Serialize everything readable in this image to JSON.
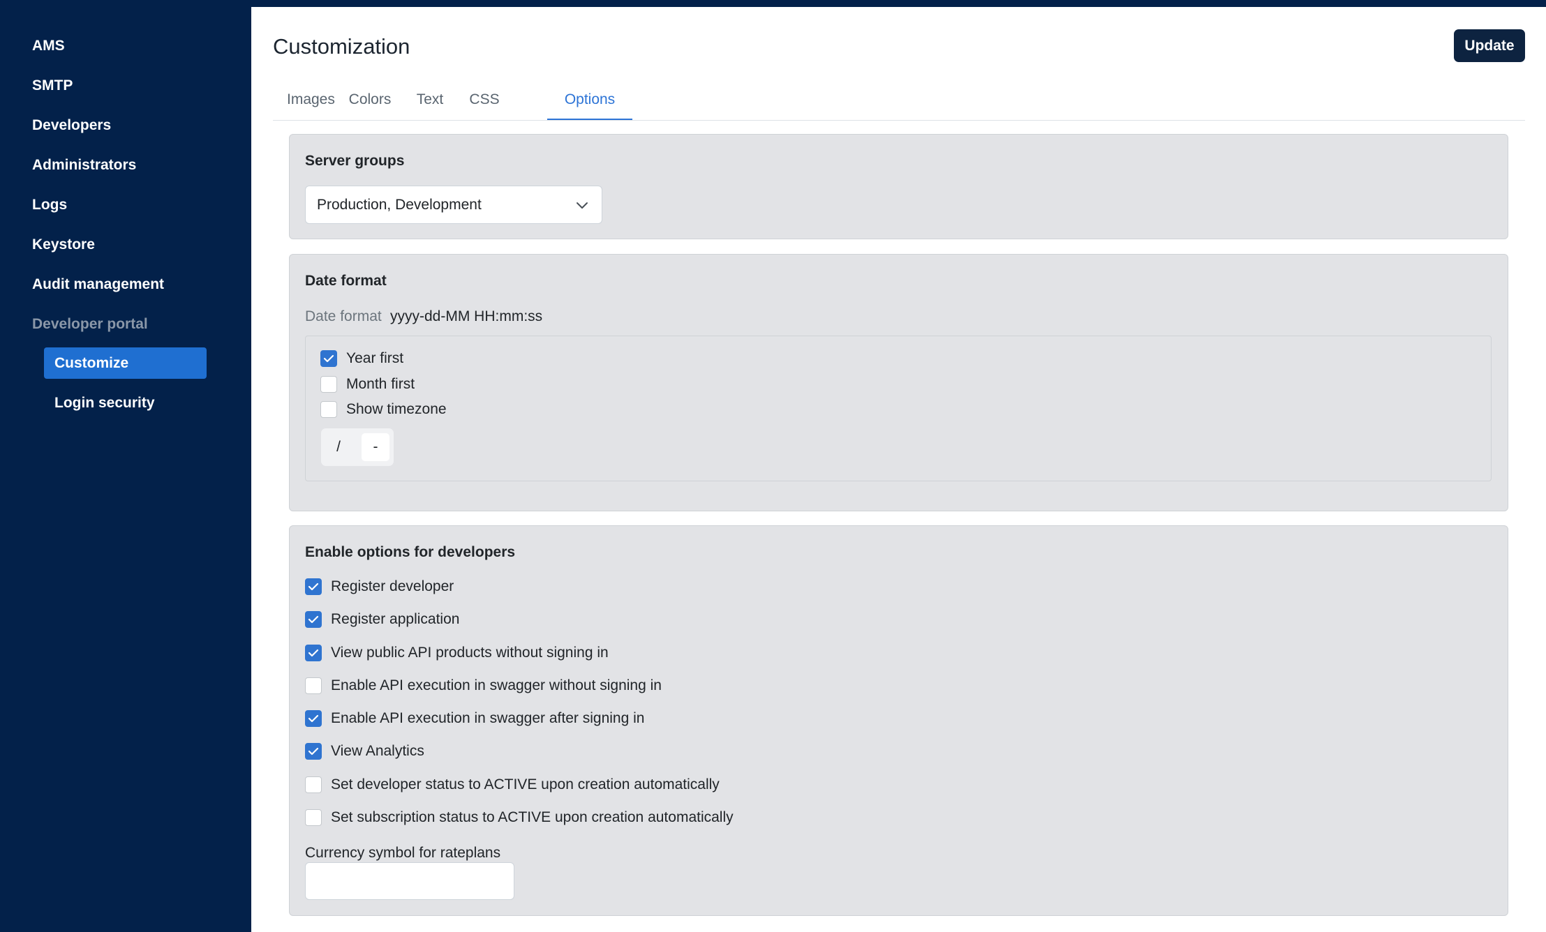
{
  "sidebar": {
    "items": [
      {
        "label": "AMS"
      },
      {
        "label": "SMTP"
      },
      {
        "label": "Developers"
      },
      {
        "label": "Administrators"
      },
      {
        "label": "Logs"
      },
      {
        "label": "Keystore"
      },
      {
        "label": "Audit management"
      },
      {
        "label": "Developer portal"
      }
    ],
    "sub_items": [
      {
        "label": "Customize",
        "active": true
      },
      {
        "label": "Login security",
        "active": false
      }
    ]
  },
  "header": {
    "title": "Customization",
    "update_label": "Update"
  },
  "tabs": [
    {
      "label": "Images"
    },
    {
      "label": "Colors"
    },
    {
      "label": "Text"
    },
    {
      "label": "CSS"
    },
    {
      "label": "Options",
      "active": true
    }
  ],
  "server_groups": {
    "title": "Server groups",
    "selected": "Production, Development"
  },
  "date_format": {
    "title": "Date format",
    "label": "Date format",
    "value": "yyyy-dd-MM HH:mm:ss",
    "options": [
      {
        "label": "Year first",
        "checked": true
      },
      {
        "label": "Month first",
        "checked": false
      },
      {
        "label": "Show timezone",
        "checked": false
      }
    ],
    "separators": [
      {
        "label": "/",
        "active": false
      },
      {
        "label": "-",
        "active": true
      }
    ]
  },
  "developer_options": {
    "title": "Enable options for developers",
    "options": [
      {
        "label": "Register developer",
        "checked": true
      },
      {
        "label": "Register application",
        "checked": true
      },
      {
        "label": "View public API products without signing in",
        "checked": true
      },
      {
        "label": "Enable API execution in swagger without signing in",
        "checked": false
      },
      {
        "label": "Enable API execution in swagger after signing in",
        "checked": true
      },
      {
        "label": "View Analytics",
        "checked": true
      },
      {
        "label": "Set developer status to ACTIVE upon creation automatically",
        "checked": false
      },
      {
        "label": "Set subscription status to ACTIVE upon creation automatically",
        "checked": false
      }
    ],
    "currency_label": "Currency symbol for rateplans",
    "currency_value": ""
  },
  "colors": {
    "sidebar_bg": "#03214a",
    "active_nav": "#1f6fd1",
    "accent": "#2d74d6",
    "update_bg": "#0d2340"
  }
}
